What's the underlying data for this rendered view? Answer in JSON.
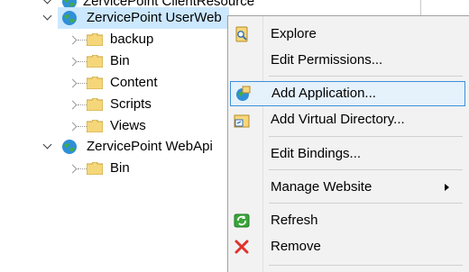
{
  "tree": {
    "partial_label": "ZervicePoint ClientResource",
    "userweb": {
      "label": "ZervicePoint UserWeb",
      "children": [
        "backup",
        "Bin",
        "Content",
        "Scripts",
        "Views"
      ]
    },
    "webapi": {
      "label": "ZervicePoint WebApi",
      "children": [
        "Bin"
      ]
    }
  },
  "context_menu": {
    "items": [
      {
        "label": "Explore",
        "icon": "explore-icon"
      },
      {
        "label": "Edit Permissions...",
        "icon": ""
      },
      {
        "label": "Add Application...",
        "icon": "add-application-icon"
      },
      {
        "label": "Add Virtual Directory...",
        "icon": "add-virtual-directory-icon"
      },
      {
        "label": "Edit Bindings...",
        "icon": ""
      },
      {
        "label": "Manage Website",
        "icon": "submenu-arrow-icon"
      },
      {
        "label": "Refresh",
        "icon": "refresh-icon"
      },
      {
        "label": "Remove",
        "icon": "remove-icon"
      }
    ]
  },
  "colors": {
    "selection": "#cce8ff",
    "menu_bg": "#f2f2f2",
    "hover_border": "#3c8fd8",
    "folder": "#f5d77a",
    "remove": "#e0322b"
  }
}
